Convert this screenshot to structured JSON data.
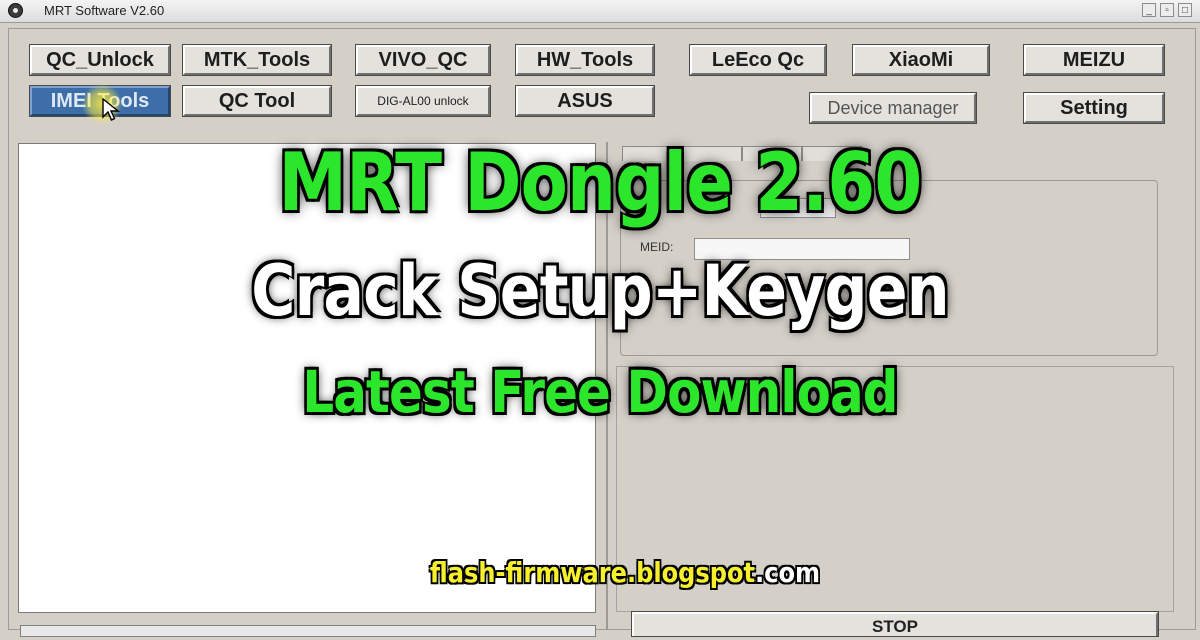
{
  "window": {
    "title": "MRT Software V2.60",
    "controls": [
      "_",
      "▫",
      "□"
    ]
  },
  "buttons": {
    "qc_unlock": "QC_Unlock",
    "mtk_tools": "MTK_Tools",
    "vivo_qc": "VIVO_QC",
    "hw_tools": "HW_Tools",
    "leeco_qc": "LeEco Qc",
    "xiaomi": "XiaoMi",
    "meizu": "MEIZU",
    "imei_tools": "IMEI Tools",
    "qc_tool": "QC Tool",
    "dig_al00_unlock": "DIG-AL00 unlock",
    "asus": "ASUS",
    "device_manager": "Device manager",
    "setting": "Setting",
    "stop": "STOP"
  },
  "imei_panel": {
    "meid_label": "MEID:",
    "meid_value": ""
  },
  "banner": {
    "line1": "MRT Dongle 2.60",
    "line2": "Crack Setup+Keygen",
    "line3": "Latest Free Download"
  },
  "watermark": {
    "part1": "flash-",
    "part2": "firmware.",
    "part3": "blogspot",
    "part4": ".com"
  },
  "colors": {
    "banner_green": "#2be62b",
    "banner_white": "#ffffff",
    "watermark_yellow": "#f6ef2c",
    "active_button": "#3e6ea8"
  }
}
